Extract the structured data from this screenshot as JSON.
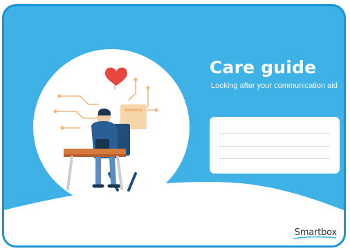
{
  "cover": {
    "title": "Care guide",
    "subtitle": "Looking after your communication aid",
    "name_box_lines": 3,
    "brand": "Smartbox"
  },
  "colors": {
    "card_blue": "#3eb2e7",
    "card_border": "#1c92d6",
    "wave_white": "#ffffff",
    "heart_red": "#e8473f",
    "brand_accent": "#38b6ea"
  },
  "icons": {
    "illustration": "person-at-desk-illustration",
    "heart": "heart-icon"
  }
}
